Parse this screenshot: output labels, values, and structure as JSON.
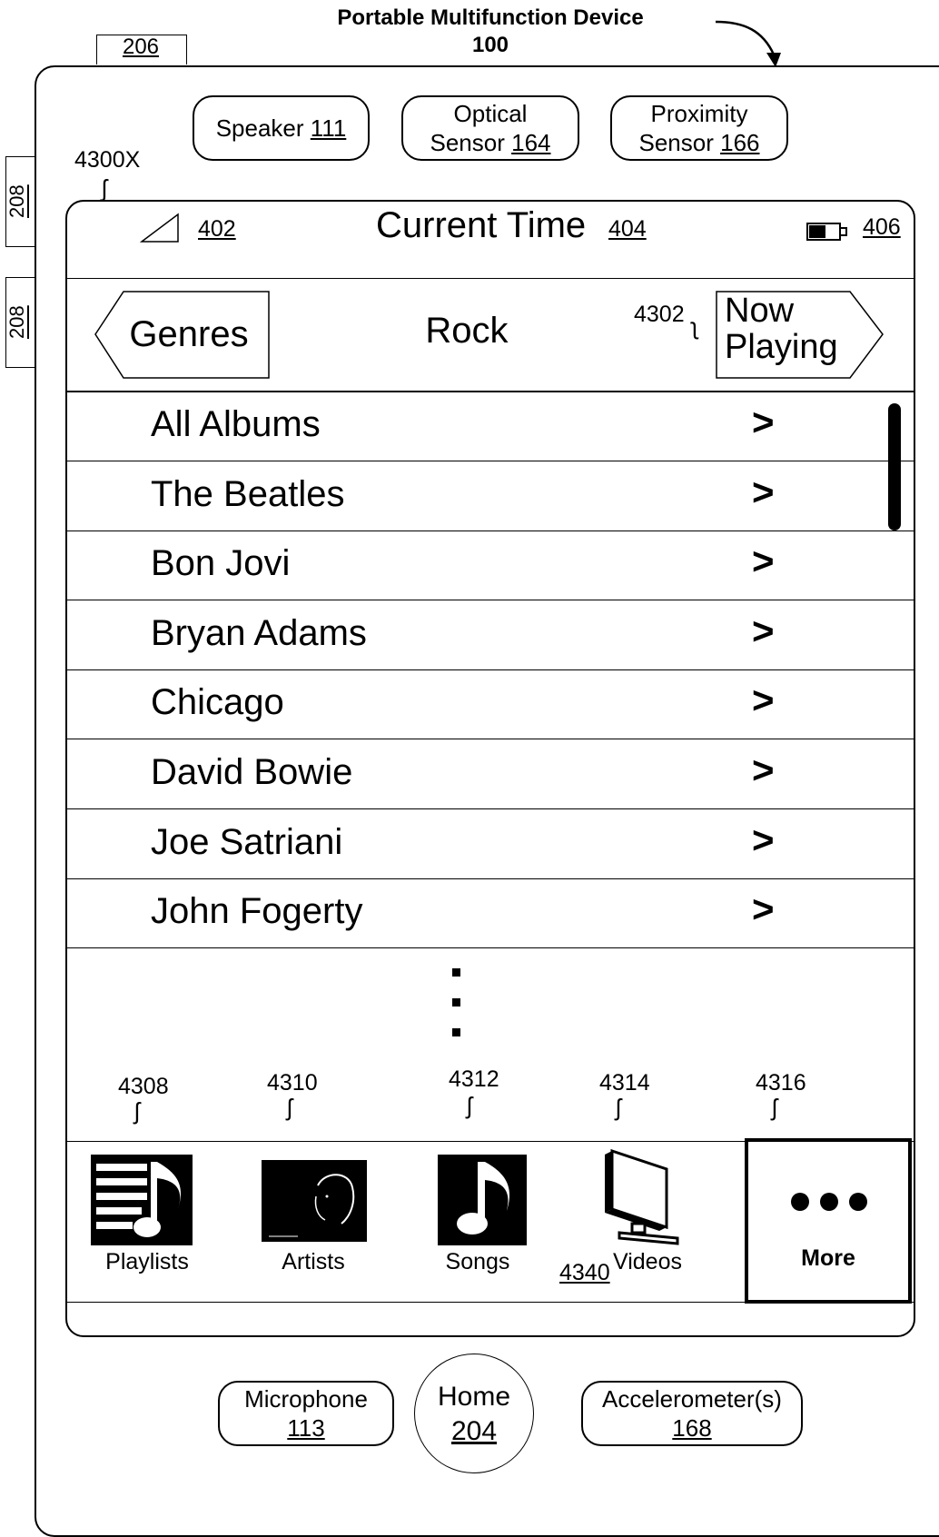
{
  "figure": {
    "title": "Portable Multifunction Device",
    "number": "100",
    "ref_top_button": "206",
    "ref_side_buttons": [
      "208",
      "208"
    ],
    "ref_screen": "4300X",
    "ref_tabbar": "4340"
  },
  "hardware_top": [
    {
      "label": "Speaker",
      "ref": "111"
    },
    {
      "label": "Optical",
      "label2": "Sensor",
      "ref": "164"
    },
    {
      "label": "Proximity",
      "label2": "Sensor",
      "ref": "166"
    }
  ],
  "hardware_bottom": {
    "microphone": {
      "label": "Microphone",
      "ref": "113"
    },
    "home": {
      "label": "Home",
      "ref": "204"
    },
    "accelerometer": {
      "label": "Accelerometer(s)",
      "ref": "168"
    }
  },
  "status_bar": {
    "signal_ref": "402",
    "time_label": "Current Time",
    "time_ref": "404",
    "battery_ref": "406"
  },
  "nav_bar": {
    "back_label": "Genres",
    "title": "Rock",
    "now_playing_ref": "4302",
    "now_playing_line1": "Now",
    "now_playing_line2": "Playing"
  },
  "list": {
    "items": [
      "All Albums",
      "The Beatles",
      "Bon Jovi",
      "Bryan Adams",
      "Chicago",
      "David Bowie",
      "Joe Satriani",
      "John Fogerty"
    ],
    "chevron": ">"
  },
  "tab_bar": {
    "tabs": [
      {
        "label": "Playlists",
        "ref": "4308",
        "icon": "playlist-icon"
      },
      {
        "label": "Artists",
        "ref": "4310",
        "icon": "artist-icon"
      },
      {
        "label": "Songs",
        "ref": "4312",
        "icon": "music-note-icon"
      },
      {
        "label": "Videos",
        "ref": "4314",
        "icon": "tv-icon"
      },
      {
        "label": "More",
        "ref": "4316",
        "icon": "ellipsis-icon",
        "selected": true
      }
    ]
  }
}
